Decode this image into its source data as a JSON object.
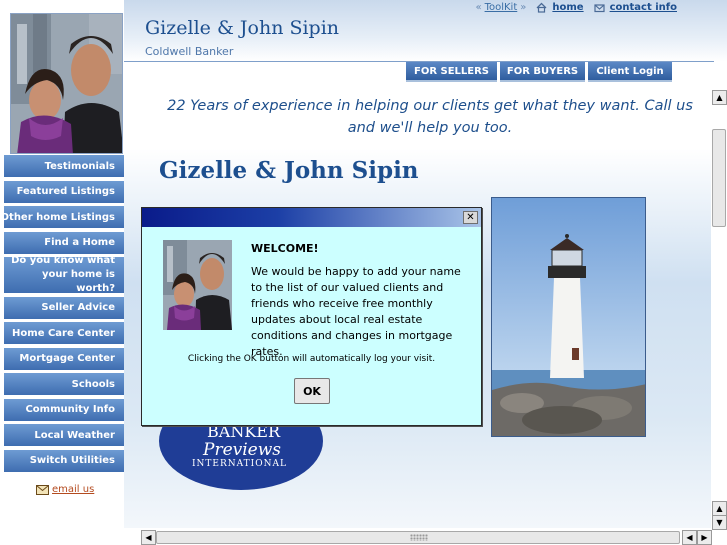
{
  "header": {
    "title": "Gizelle & John Sipin",
    "subtitle": "Coldwell Banker",
    "links": {
      "prefix": "«",
      "toolkit": "ToolKit",
      "suffix": "»",
      "home": "home",
      "contact": "contact info"
    }
  },
  "topnav": [
    "FOR SELLERS",
    "FOR BUYERS",
    "Client Login"
  ],
  "sidebar": {
    "items": [
      "Testimonials",
      "Featured Listings",
      "Other home Listings",
      "Find a Home",
      "Do you know what your home is worth?",
      "Seller Advice",
      "Home Care Center",
      "Mortgage Center",
      "Schools",
      "Community Info",
      "Local Weather",
      "Switch Utilities"
    ],
    "email_label": "email us"
  },
  "content": {
    "tagline": "22 Years of experience in helping our clients get what they want. Call us and we'll help you too.",
    "title": "Gizelle & John Sipin",
    "logo": {
      "line1": "BANKER",
      "line2": "Previews",
      "line3": "INTERNATIONAL"
    }
  },
  "dialog": {
    "close_glyph": "✕",
    "heading": "WELCOME!",
    "message": "We would be happy to add your name to the list of our valued clients and friends who receive free monthly updates about local real estate conditions and changes in mortgage rates.",
    "note": "Clicking the OK button will automatically log your visit.",
    "ok_label": "OK"
  },
  "colors": {
    "brand_blue": "#1d4f8f",
    "nav_blue": "#3e6db0",
    "dialog_bg": "#ccffff"
  }
}
